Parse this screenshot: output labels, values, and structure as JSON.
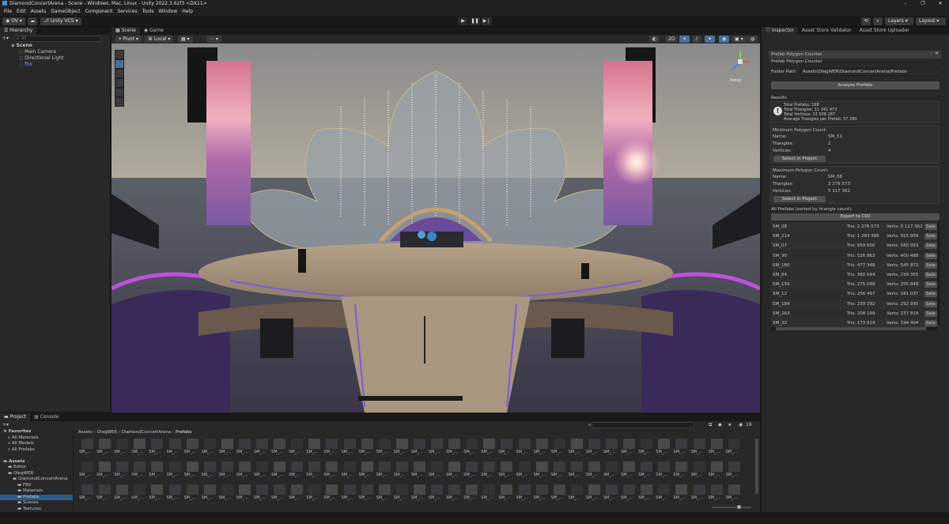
{
  "window": {
    "title": "DiamondConcertArena - Scene - Windows, Mac, Linux - Unity 2022.3.62f3 <DX11>"
  },
  "menu": [
    "File",
    "Edit",
    "Assets",
    "GameObject",
    "Component",
    "Services",
    "Tools",
    "Window",
    "Help"
  ],
  "toolbar": {
    "account": "OV",
    "vcs": "Unity VCS",
    "layers": "Layers",
    "layout": "Layout"
  },
  "hierarchy": {
    "tab": "Hierarchy",
    "search_placeholder": "All",
    "items": [
      {
        "label": "Scene",
        "indent": 0
      },
      {
        "label": "Main Camera",
        "indent": 1
      },
      {
        "label": "Directional Light",
        "indent": 1
      },
      {
        "label": "fbx",
        "indent": 1
      }
    ]
  },
  "scene": {
    "tabs": [
      "Scene",
      "Game"
    ],
    "pivot": "Pivot",
    "local": "Local",
    "mode_2d": "2D",
    "gizmo_label": "Persp"
  },
  "inspector": {
    "tabs": [
      "Inspector",
      "Asset Store Validator",
      "Asset Store Uploader"
    ],
    "window_tab": "Prefab Polygon Counter",
    "header": "Prefab Polygon Counter",
    "folder_label": "Folder Path:",
    "folder_value": "Assets\\OlegWER\\DiamondConcertArena\\Prefabs",
    "analyze_button": "Analyze Prefabs",
    "results_label": "Results",
    "summary": [
      "Total Prefabs: 198",
      "Total Triangles: 11 341 473",
      "Total Vertices: 13 508 287",
      "Average Triangles per Prefab: 57 280"
    ],
    "min": {
      "title": "Minimum Polygon Count:",
      "name_label": "Name:",
      "name": "SM_51",
      "tri_label": "Triangles:",
      "triangles": "2",
      "vert_label": "Vertices:",
      "vertices": "4",
      "select_button": "Select in Project"
    },
    "max": {
      "title": "Maximum Polygon Count:",
      "name_label": "Name:",
      "name": "SM_08",
      "tri_label": "Triangles:",
      "triangles": "2 276 573",
      "vert_label": "Vertices:",
      "vertices": "5 117 362",
      "select_button": "Select in Project"
    },
    "all_title": "All Prefabs (sorted by triangle count):",
    "export_button": "Export to CSV",
    "select_short": "Sele",
    "rows": [
      {
        "name": "SM_08",
        "tris": "Tris: 2 276 573",
        "verts": "Verts: 5 117 362"
      },
      {
        "name": "SM_214",
        "tris": "Tris: 1 283 986",
        "verts": "Verts: 915 959"
      },
      {
        "name": "SM_07",
        "tris": "Tris: 659 600",
        "verts": "Verts: 560 053"
      },
      {
        "name": "SM_90",
        "tris": "Tris: 526 863",
        "verts": "Verts: 400 488"
      },
      {
        "name": "SM_160",
        "tris": "Tris: 477 348",
        "verts": "Verts: 545 872"
      },
      {
        "name": "SM_84",
        "tris": "Tris: 360 644",
        "verts": "Verts: 239 355"
      },
      {
        "name": "SM_159",
        "tris": "Tris: 275 048",
        "verts": "Verts: 255 848"
      },
      {
        "name": "SM_12",
        "tris": "Tris: 256 497",
        "verts": "Verts: 281 037"
      },
      {
        "name": "SM_184",
        "tris": "Tris: 239 292",
        "verts": "Verts: 292 935"
      },
      {
        "name": "SM_263",
        "tris": "Tris: 208 199",
        "verts": "Verts: 237 819"
      },
      {
        "name": "SM_22",
        "tris": "Tris: 173 819",
        "verts": "Verts: 194 404"
      }
    ]
  },
  "project": {
    "tabs": [
      "Project",
      "Console"
    ],
    "tree": [
      {
        "label": "Favorites",
        "indent": 0,
        "bold": true
      },
      {
        "label": "All Materials",
        "indent": 1
      },
      {
        "label": "All Models",
        "indent": 1
      },
      {
        "label": "All Prefabs",
        "indent": 1
      },
      {
        "label": "",
        "indent": 0
      },
      {
        "label": "Assets",
        "indent": 0,
        "bold": true
      },
      {
        "label": "Editor",
        "indent": 1
      },
      {
        "label": "OlegWER",
        "indent": 1
      },
      {
        "label": "DiamondConcertArena",
        "indent": 2
      },
      {
        "label": "FBX",
        "indent": 3
      },
      {
        "label": "Materials",
        "indent": 3
      },
      {
        "label": "Prefabs",
        "indent": 3,
        "selected": true
      },
      {
        "label": "Scenes",
        "indent": 3
      },
      {
        "label": "Textures",
        "indent": 3
      }
    ],
    "breadcrumb": [
      "Assets",
      "OlegWER",
      "DiamondConcertArena",
      "Prefabs"
    ],
    "asset_label": "SM_...",
    "count": "16"
  }
}
